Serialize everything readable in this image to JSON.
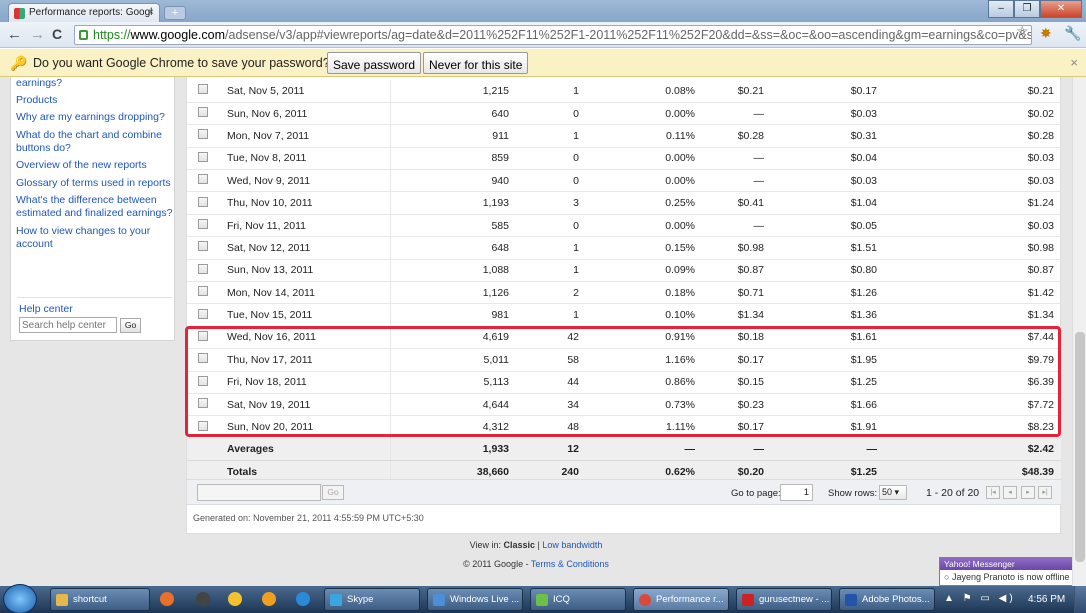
{
  "browser": {
    "tab_title": "Performance reports: Googl",
    "tab_close": "×",
    "new_tab": "+",
    "url_https": "https://",
    "url_domain": "www.google.com",
    "url_rest": "/adsense/v3/app#viewreports/ag=date&d=2011%252F11%252F1-2011%252F11%252F20&dd=&ss=&oc=&oo=ascending&gm=earnings&co=pv&sg",
    "back_icon": "←",
    "forward_icon": "→",
    "reload_icon": "C",
    "star_icon": "☆"
  },
  "infobar": {
    "message": "Do you want Google Chrome to save your password?",
    "save_label": "Save password",
    "never_label": "Never for this site",
    "close": "×"
  },
  "sidebar": {
    "links": [
      {
        "label": "earnings?"
      },
      {
        "label": "Products"
      },
      {
        "label": "Why are my earnings dropping?"
      },
      {
        "label": "What do the chart and combine buttons do?"
      },
      {
        "label": "Overview of the new reports"
      },
      {
        "label": "Glossary of terms used in reports"
      },
      {
        "label": "What's the difference between estimated and finalized earnings?"
      },
      {
        "label": "How to view changes to your account"
      }
    ],
    "help_center": "Help center",
    "search_placeholder": "Search help center",
    "go_label": "Go"
  },
  "table": {
    "rows": [
      {
        "date": "Sat, Nov 5, 2011",
        "views": "1,215",
        "clicks": "1",
        "ctr": "0.08%",
        "cpc": "$0.21",
        "rpm": "$0.17",
        "earnings": "$0.21"
      },
      {
        "date": "Sun, Nov 6, 2011",
        "views": "640",
        "clicks": "0",
        "ctr": "0.00%",
        "cpc": "—",
        "rpm": "$0.03",
        "earnings": "$0.02"
      },
      {
        "date": "Mon, Nov 7, 2011",
        "views": "911",
        "clicks": "1",
        "ctr": "0.11%",
        "cpc": "$0.28",
        "rpm": "$0.31",
        "earnings": "$0.28"
      },
      {
        "date": "Tue, Nov 8, 2011",
        "views": "859",
        "clicks": "0",
        "ctr": "0.00%",
        "cpc": "—",
        "rpm": "$0.04",
        "earnings": "$0.03"
      },
      {
        "date": "Wed, Nov 9, 2011",
        "views": "940",
        "clicks": "0",
        "ctr": "0.00%",
        "cpc": "—",
        "rpm": "$0.03",
        "earnings": "$0.03"
      },
      {
        "date": "Thu, Nov 10, 2011",
        "views": "1,193",
        "clicks": "3",
        "ctr": "0.25%",
        "cpc": "$0.41",
        "rpm": "$1.04",
        "earnings": "$1.24"
      },
      {
        "date": "Fri, Nov 11, 2011",
        "views": "585",
        "clicks": "0",
        "ctr": "0.00%",
        "cpc": "—",
        "rpm": "$0.05",
        "earnings": "$0.03"
      },
      {
        "date": "Sat, Nov 12, 2011",
        "views": "648",
        "clicks": "1",
        "ctr": "0.15%",
        "cpc": "$0.98",
        "rpm": "$1.51",
        "earnings": "$0.98"
      },
      {
        "date": "Sun, Nov 13, 2011",
        "views": "1,088",
        "clicks": "1",
        "ctr": "0.09%",
        "cpc": "$0.87",
        "rpm": "$0.80",
        "earnings": "$0.87"
      },
      {
        "date": "Mon, Nov 14, 2011",
        "views": "1,126",
        "clicks": "2",
        "ctr": "0.18%",
        "cpc": "$0.71",
        "rpm": "$1.26",
        "earnings": "$1.42"
      },
      {
        "date": "Tue, Nov 15, 2011",
        "views": "981",
        "clicks": "1",
        "ctr": "0.10%",
        "cpc": "$1.34",
        "rpm": "$1.36",
        "earnings": "$1.34"
      },
      {
        "date": "Wed, Nov 16, 2011",
        "views": "4,619",
        "clicks": "42",
        "ctr": "0.91%",
        "cpc": "$0.18",
        "rpm": "$1.61",
        "earnings": "$7.44"
      },
      {
        "date": "Thu, Nov 17, 2011",
        "views": "5,011",
        "clicks": "58",
        "ctr": "1.16%",
        "cpc": "$0.17",
        "rpm": "$1.95",
        "earnings": "$9.79"
      },
      {
        "date": "Fri, Nov 18, 2011",
        "views": "5,113",
        "clicks": "44",
        "ctr": "0.86%",
        "cpc": "$0.15",
        "rpm": "$1.25",
        "earnings": "$6.39"
      },
      {
        "date": "Sat, Nov 19, 2011",
        "views": "4,644",
        "clicks": "34",
        "ctr": "0.73%",
        "cpc": "$0.23",
        "rpm": "$1.66",
        "earnings": "$7.72"
      },
      {
        "date": "Sun, Nov 20, 2011",
        "views": "4,312",
        "clicks": "48",
        "ctr": "1.11%",
        "cpc": "$0.17",
        "rpm": "$1.91",
        "earnings": "$8.23"
      }
    ],
    "averages": {
      "label": "Averages",
      "views": "1,933",
      "clicks": "12",
      "ctr": "—",
      "cpc": "—",
      "rpm": "—",
      "earnings": "$2.42"
    },
    "totals": {
      "label": "Totals",
      "views": "38,660",
      "clicks": "240",
      "ctr": "0.62%",
      "cpc": "$0.20",
      "rpm": "$1.25",
      "earnings": "$48.39"
    },
    "highlight_color": "#e5243b"
  },
  "pager": {
    "go_label": "Go",
    "goto_label": "Go to page:",
    "page_value": "1",
    "show_rows_label": "Show rows:",
    "rows_value": "50 ▾",
    "range": "1 - 20 of 20",
    "first": "|◂",
    "prev": "◂",
    "next": "▸",
    "last": "▸|"
  },
  "generated": "Generated on: November 21, 2011 4:55:59 PM UTC+5:30",
  "footer": {
    "view_in": "View in: ",
    "classic": "Classic",
    "sep": " | ",
    "low_bandwidth": "Low bandwidth",
    "copyright": "© 2011 Google - ",
    "terms": "Terms & Conditions"
  },
  "messenger": {
    "title": "Yahoo! Messenger",
    "close": "×",
    "status": "Jayeng Pranoto is now offline"
  },
  "taskbar": {
    "tasks": [
      {
        "label": "shortcut",
        "color": "#e6b84a"
      },
      {
        "label": "Skype",
        "color": "#3aa6e0"
      },
      {
        "label": "Windows Live ...",
        "color": "#4a8fd8"
      },
      {
        "label": "ICQ",
        "color": "#6cc04a"
      },
      {
        "label": "Performance r...",
        "color": "#d94a3a"
      },
      {
        "label": "gurusectnew - ...",
        "color": "#cc2222"
      },
      {
        "label": "Adobe Photos...",
        "color": "#2255aa"
      }
    ],
    "time": "4:56 PM",
    "tray_icons": "▲ ⚑ ▭ ◀)"
  }
}
